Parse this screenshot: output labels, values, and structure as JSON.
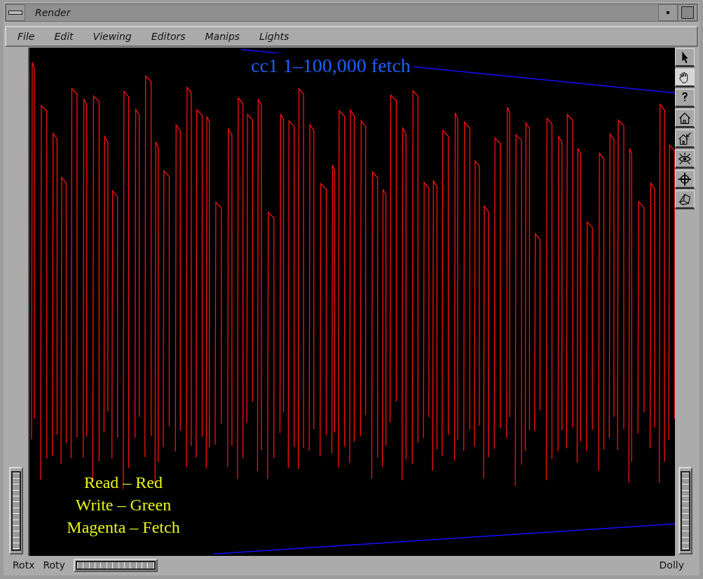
{
  "window": {
    "title": "Render"
  },
  "menu": [
    "File",
    "Edit",
    "Viewing",
    "Editors",
    "Manips",
    "Lights"
  ],
  "viewer": {
    "title": "cc1  1–100,000 fetch",
    "legend": [
      "Read – Red",
      "Write – Green",
      "Magenta – Fetch"
    ]
  },
  "bottom_bar": {
    "left_labels": [
      "Rotx",
      "Roty"
    ],
    "right_label": "Dolly"
  }
}
